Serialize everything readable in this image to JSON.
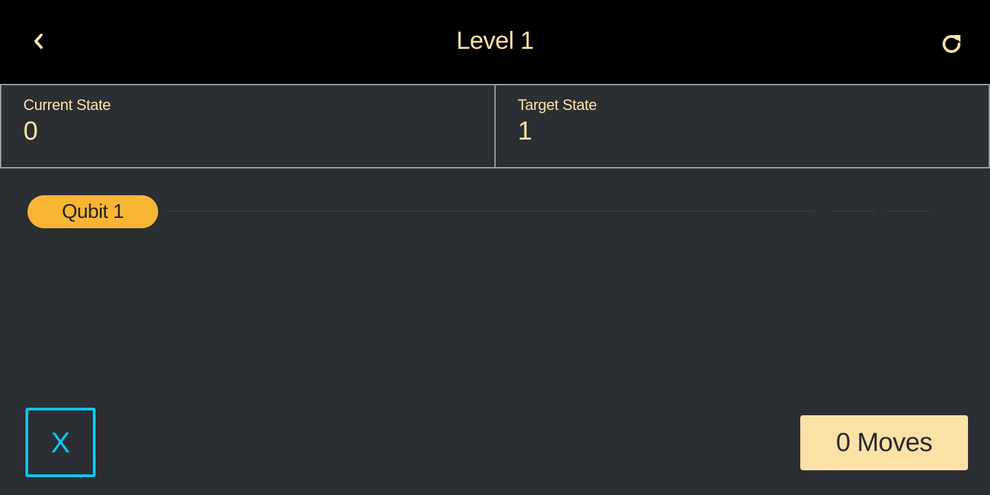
{
  "header": {
    "title": "Level 1",
    "back_icon": "chevron-left-icon",
    "reset_icon": "refresh-icon"
  },
  "states": {
    "current": {
      "label": "Current State",
      "value": "0"
    },
    "target": {
      "label": "Target State",
      "value": "1"
    }
  },
  "circuit": {
    "qubits": [
      {
        "label": "Qubit 1"
      }
    ]
  },
  "gates": [
    {
      "label": "X",
      "color": "#0ac8f5"
    }
  ],
  "moves": {
    "label": "0 Moves"
  },
  "colors": {
    "background": "#2b2e33",
    "header_bg": "#000000",
    "accent_text": "#fde2a8",
    "qubit_pill": "#f9b635",
    "gate_x": "#0ac8f5"
  }
}
